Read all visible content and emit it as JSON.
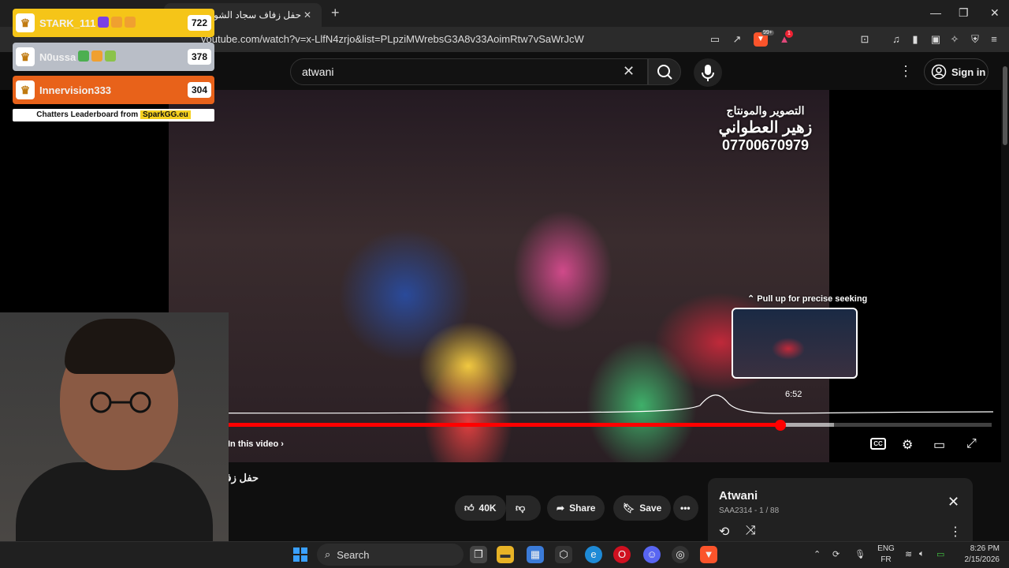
{
  "browser": {
    "tab_title": "حفل زفاف سجاد الشويلي ز",
    "url": "youtube.com/watch?v=x-LlfN4zrjo&list=PLpziMWrebsG3A8v33AoimRtw7vSaWrJcW",
    "brave_badge": "99+",
    "notif_badge": "1"
  },
  "youtube": {
    "search_value": "atwani",
    "signin_label": "Sign in",
    "watermark": {
      "line1": "التصوير والمونتاج",
      "line2": "زهير العطواني",
      "line3": "07700670979"
    },
    "pull_up": "Pull up for precise seeking",
    "hover_time": "6:52",
    "in_this_video": "In this video",
    "progress": {
      "played": 0.785,
      "buffered": 0.84
    },
    "video_title": "حفل زفاف",
    "likes": "40K",
    "share_label": "Share",
    "save_label": "Save",
    "playlist": {
      "title": "Atwani",
      "subtitle": "SAA2314 - 1 / 88"
    }
  },
  "leaderboard": {
    "rows": [
      {
        "name": "STARK_111",
        "score": "722",
        "color": "#f5c518"
      },
      {
        "name": "N0ussa",
        "score": "378",
        "color": "#b9bec7"
      },
      {
        "name": "Innervision333",
        "score": "304",
        "color": "#e8621a"
      }
    ],
    "footer_text": "Chatters Leaderboard from",
    "footer_brand": "SparkGG.eu"
  },
  "taskbar": {
    "search_label": "Search",
    "lang_line1": "ENG",
    "lang_line2": "FR",
    "time": "8:26 PM",
    "date": "2/15/2026"
  },
  "colors": {
    "accent_red": "#ff0000",
    "bg": "#0f0f0f"
  }
}
